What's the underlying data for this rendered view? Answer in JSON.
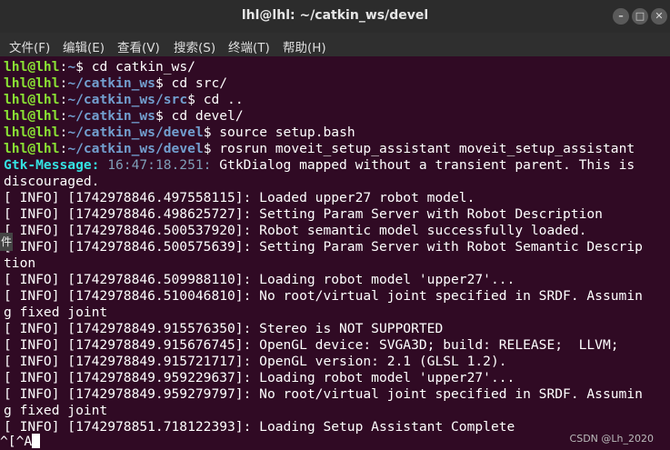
{
  "window": {
    "title": "lhl@lhl: ~/catkin_ws/devel"
  },
  "menu": [
    "文件(F)",
    "编辑(E)",
    "查看(V)",
    "搜索(S)",
    "终端(T)",
    "帮助(H)"
  ],
  "prompts": [
    {
      "user": "lhl@lhl",
      "path": "~",
      "cmd": " cd catkin_ws/"
    },
    {
      "user": "lhl@lhl",
      "path": "~/catkin_ws",
      "cmd": " cd src/"
    },
    {
      "user": "lhl@lhl",
      "path": "~/catkin_ws/src",
      "cmd": " cd .."
    },
    {
      "user": "lhl@lhl",
      "path": "~/catkin_ws",
      "cmd": " cd devel/"
    },
    {
      "user": "lhl@lhl",
      "path": "~/catkin_ws/devel",
      "cmd": " source setup.bash"
    },
    {
      "user": "lhl@lhl",
      "path": "~/catkin_ws/devel",
      "cmd": " rosrun moveit_setup_assistant moveit_setup_assistant"
    }
  ],
  "gtk": {
    "prefix": "Gtk-Message:",
    "time": "16:47:18.251:",
    "msg": " GtkDialog mapped without a transient parent. This is",
    "cont": "discouraged."
  },
  "log": [
    "[ INFO] [1742978846.497558115]: Loaded upper27 robot model.",
    "[ INFO] [1742978846.498625727]: Setting Param Server with Robot Description",
    "[ INFO] [1742978846.500537920]: Robot semantic model successfully loaded.",
    "[ INFO] [1742978846.500575639]: Setting Param Server with Robot Semantic Descrip",
    "tion",
    "[ INFO] [1742978846.509988110]: Loading robot model 'upper27'...",
    "[ INFO] [1742978846.510046810]: No root/virtual joint specified in SRDF. Assumin",
    "g fixed joint",
    "[ INFO] [1742978849.915576350]: Stereo is NOT SUPPORTED",
    "[ INFO] [1742978849.915676745]: OpenGL device: SVGA3D; build: RELEASE;  LLVM;",
    "[ INFO] [1742978849.915721717]: OpenGL version: 2.1 (GLSL 1.2).",
    "[ INFO] [1742978849.959229637]: Loading robot model 'upper27'...",
    "[ INFO] [1742978849.959279797]: No root/virtual joint specified in SRDF. Assumin",
    "g fixed joint",
    "[ INFO] [1742978851.718122393]: Loading Setup Assistant Complete"
  ],
  "last_input": "^[^A",
  "side_tab": "件",
  "watermark": "CSDN @Lh_2020",
  "colors": {
    "background": "#300a24",
    "user": "#8ae234",
    "path": "#729fcf",
    "gtk": "#34e2e2"
  }
}
